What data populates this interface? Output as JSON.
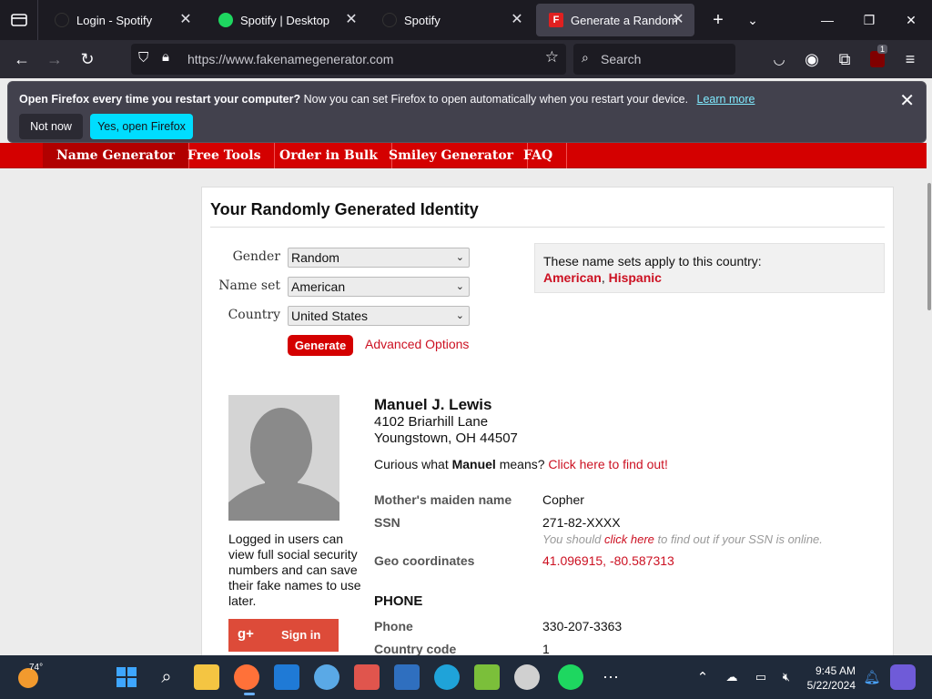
{
  "browser": {
    "tabs": [
      {
        "title": "Login - Spotify"
      },
      {
        "title": "Spotify | Desktop"
      },
      {
        "title": "Spotify"
      },
      {
        "title": "Generate a Random Na"
      }
    ],
    "url": "https://www.fakenamegenerator.com",
    "search_placeholder": "Search",
    "extension_badge": "1"
  },
  "notification": {
    "bold_text": "Open Firefox every time you restart your computer?",
    "text": "Now you can set Firefox to open automatically when you restart your device.",
    "link": "Learn more",
    "not_now": "Not now",
    "yes_open": "Yes, open Firefox"
  },
  "site_menu": [
    "Name Generator",
    "Free Tools",
    "Order in Bulk",
    "Smiley Generator",
    "FAQ"
  ],
  "form": {
    "heading": "Your Randomly Generated Identity",
    "gender_label": "Gender",
    "gender_value": "Random",
    "nameset_label": "Name set",
    "nameset_value": "American",
    "country_label": "Country",
    "country_value": "United States",
    "generate": "Generate",
    "advanced": "Advanced Options",
    "note_text": "These name sets apply to this country:",
    "note_link1": "American",
    "note_link2": "Hispanic"
  },
  "identity": {
    "name": "Manuel J. Lewis",
    "street": "4102 Briarhill Lane",
    "city": "Youngstown, OH 44507",
    "curious_pre": "Curious what",
    "first_name": "Manuel",
    "curious_mid": "means?",
    "curious_link": "Click here to find out!",
    "login_note": "Logged in users can view full social security numbers and can save their fake names to use later.",
    "signin": "Sign in",
    "gplus": "g+",
    "maiden_label": "Mother's maiden name",
    "maiden_value": "Copher",
    "ssn_label": "SSN",
    "ssn_value": "271-82-XXXX",
    "ssn_note_pre": "You should",
    "ssn_note_link": "click here",
    "ssn_note_post": "to find out if your SSN is online.",
    "geo_label": "Geo coordinates",
    "geo_value": "41.096915, -80.587313",
    "phone_heading": "PHONE",
    "phone_label": "Phone",
    "phone_value": "330-207-3363",
    "cc_label": "Country code",
    "cc_value": "1"
  },
  "taskbar": {
    "weather": "74°",
    "time": "9:45 AM",
    "date": "5/22/2024"
  }
}
